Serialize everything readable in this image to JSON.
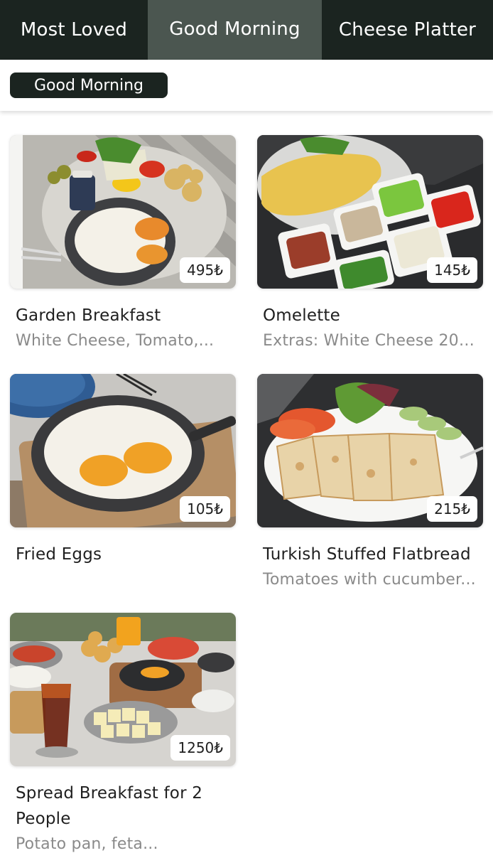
{
  "tabs": [
    {
      "label": "Most Loved"
    },
    {
      "label": "Good Morning"
    },
    {
      "label": "Cheese Platter"
    }
  ],
  "subcategory": {
    "label": "Good Morning"
  },
  "products": [
    {
      "name": "Garden Breakfast",
      "description": "White Cheese, Tomato,...",
      "price": "495₺"
    },
    {
      "name": "Omelette",
      "description": "Extras: White Cheese 20₺...",
      "price": "145₺"
    },
    {
      "name": "Fried Eggs",
      "description": "",
      "price": "105₺"
    },
    {
      "name": "Turkish Stuffed Flatbread",
      "description": "Tomatoes with cucumber...",
      "price": "215₺"
    },
    {
      "name": "Spread Breakfast for 2 People",
      "description": "Potato pan, feta...",
      "price": "1250₺"
    }
  ]
}
